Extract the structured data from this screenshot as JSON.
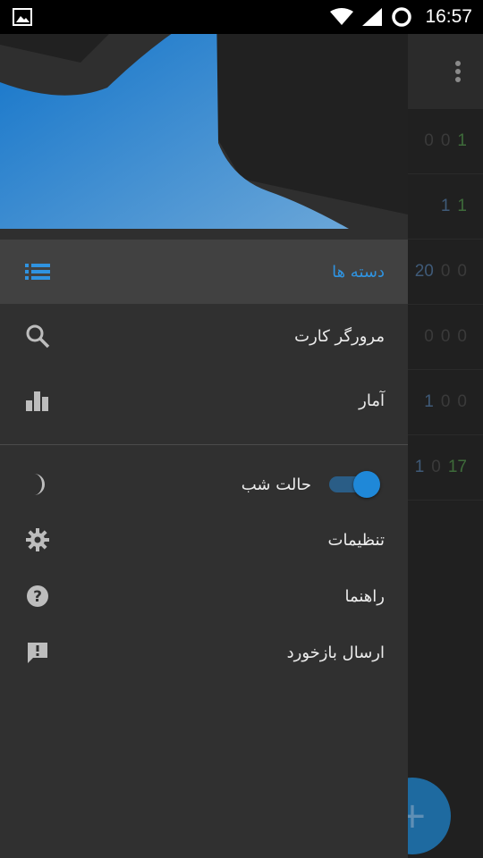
{
  "status_bar": {
    "time": "16:57",
    "icons": [
      "image-icon",
      "wifi-icon",
      "signal-icon",
      "battery-circle-icon"
    ]
  },
  "background_app": {
    "rows": [
      {
        "values": [
          "0",
          "0",
          "1"
        ]
      },
      {
        "values": [
          "1",
          "1"
        ]
      },
      {
        "values": [
          "20",
          "0",
          "0"
        ]
      },
      {
        "values": [
          "0",
          "0",
          "0"
        ]
      },
      {
        "values": [
          "1",
          "0",
          "0"
        ]
      },
      {
        "values": [
          "1",
          "0",
          "17"
        ]
      }
    ],
    "fab_label": "+"
  },
  "drawer": {
    "items": [
      {
        "label": "دسته ها",
        "icon": "list-icon",
        "active": true
      },
      {
        "label": "مرورگر کارت",
        "icon": "search-icon"
      },
      {
        "label": "آمار",
        "icon": "bar-chart-icon"
      }
    ],
    "settings": [
      {
        "label": "حالت شب",
        "icon": "moon-icon",
        "toggle_on": true
      },
      {
        "label": "تنظیمات",
        "icon": "gear-icon"
      },
      {
        "label": "راهنما",
        "icon": "help-icon"
      },
      {
        "label": "ارسال بازخورد",
        "icon": "feedback-icon"
      }
    ]
  },
  "colors": {
    "accent": "#2f93e0",
    "drawer_bg": "#303030",
    "active_row_bg": "#414141",
    "header_blue": "#1a7cd0"
  }
}
